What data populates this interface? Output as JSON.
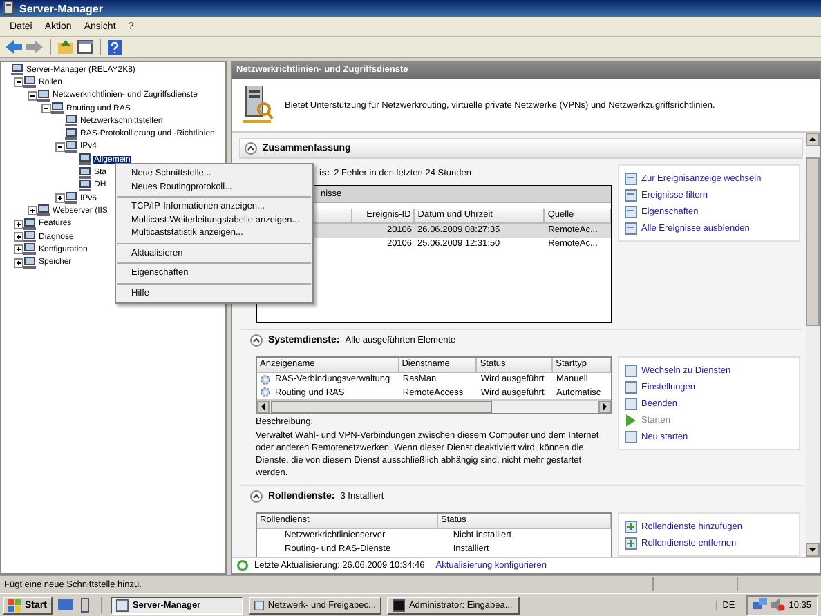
{
  "window": {
    "title": "Server-Manager"
  },
  "menu": [
    "Datei",
    "Aktion",
    "Ansicht",
    "?"
  ],
  "tree": [
    {
      "label": "Server-Manager (RELAY2K8)",
      "selected": false,
      "children": [
        {
          "label": "Rollen",
          "selected": false,
          "expanded": true,
          "children": [
            {
              "label": "Netzwerkrichtlinien- und Zugriffsdienste",
              "selected": false,
              "expanded": true,
              "children": [
                {
                  "label": "Routing und RAS",
                  "selected": false,
                  "expanded": true,
                  "children": [
                    {
                      "label": "Netzwerkschnittstellen",
                      "selected": false
                    },
                    {
                      "label": "RAS-Protokollierung und -Richtlinien",
                      "selected": false
                    },
                    {
                      "label": "IPv4",
                      "selected": false,
                      "expanded": true,
                      "children": [
                        {
                          "label": "Allgemein",
                          "selected": true
                        },
                        {
                          "label": "Sta",
                          "selected": false
                        },
                        {
                          "label": "DH",
                          "selected": false
                        }
                      ]
                    },
                    {
                      "label": "IPv6",
                      "selected": false,
                      "expanded": false
                    }
                  ]
                }
              ]
            },
            {
              "label": "Webserver (IIS",
              "selected": false,
              "expanded": false
            }
          ]
        },
        {
          "label": "Features",
          "selected": false,
          "expanded": false
        },
        {
          "label": "Diagnose",
          "selected": false,
          "expanded": false
        },
        {
          "label": "Konfiguration",
          "selected": false,
          "expanded": false
        },
        {
          "label": "Speicher",
          "selected": false,
          "expanded": false
        }
      ]
    }
  ],
  "context_menu": [
    {
      "kind": "item",
      "label": "Neue Schnittstelle..."
    },
    {
      "kind": "item",
      "label": "Neues Routingprotokoll..."
    },
    {
      "kind": "separator"
    },
    {
      "kind": "item",
      "label": "TCP/IP-Informationen anzeigen..."
    },
    {
      "kind": "item",
      "label": "Multicast-Weiterleitungstabelle anzeigen..."
    },
    {
      "kind": "item",
      "label": "Multicaststatistik anzeigen..."
    },
    {
      "kind": "separator"
    },
    {
      "kind": "item",
      "label": "Aktualisieren"
    },
    {
      "kind": "separator"
    },
    {
      "kind": "item",
      "label": "Eigenschaften"
    },
    {
      "kind": "separator"
    },
    {
      "kind": "item",
      "label": "Hilfe"
    }
  ],
  "pane": {
    "title": "Netzwerkrichtlinien- und Zugriffsdienste",
    "description": "Bietet Unterstützung für Netzwerkrouting, virtuelle private Netzwerke (VPNs) und Netzwerkzugriffsrichtlinien."
  },
  "summary": {
    "title": "Zusammenfassung",
    "label": "is:",
    "text": "2 Fehler in den letzten 24 Stunden",
    "group_title": "nisse",
    "columns": [
      "Ereignis-ID",
      "Datum und Uhrzeit",
      "Quelle"
    ],
    "rows": [
      {
        "cells": [
          "20106",
          "26.06.2009 08:27:35",
          "RemoteAc..."
        ],
        "selected": true
      },
      {
        "cells": [
          "20106",
          "25.06.2009 12:31:50",
          "RemoteAc..."
        ],
        "selected": false
      }
    ],
    "links": [
      {
        "label": "Zur Ereignisanzeige wechseln",
        "disabled": false
      },
      {
        "label": "Ereignisse filtern",
        "disabled": false
      },
      {
        "label": "Eigenschaften",
        "disabled": false
      },
      {
        "label": "Alle Ereignisse ausblenden",
        "disabled": false
      }
    ]
  },
  "services": {
    "title": "Systemdienste:",
    "text": "Alle ausgeführten Elemente",
    "columns": [
      "Anzeigename",
      "Dienstname",
      "Status",
      "Starttyp"
    ],
    "rows": [
      [
        "RAS-Verbindungsverwaltung",
        "RasMan",
        "Wird ausgeführt",
        "Manuell"
      ],
      [
        "Routing und RAS",
        "RemoteAccess",
        "Wird ausgeführt",
        "Automatisc"
      ]
    ],
    "description_label": "Beschreibung:",
    "description": "Verwaltet Wähl- und VPN-Verbindungen zwischen diesem Computer und dem Internet oder anderen Remotenetzwerken. Wenn dieser Dienst deaktiviert wird, können die Dienste, die von diesem Dienst ausschließlich abhängig sind, nicht mehr gestartet werden.",
    "links": [
      {
        "label": "Wechseln zu Diensten",
        "disabled": false
      },
      {
        "label": "Einstellungen",
        "disabled": false
      },
      {
        "label": "Beenden",
        "disabled": false
      },
      {
        "label": "Starten",
        "disabled": true
      },
      {
        "label": "Neu starten",
        "disabled": false
      }
    ]
  },
  "role_services": {
    "title": "Rollendienste:",
    "text": "3 Installiert",
    "columns": [
      "Rollendienst",
      "Status"
    ],
    "rows": [
      [
        "Netzwerkrichtlinienserver",
        "Nicht installiert"
      ],
      [
        "Routing- und RAS-Dienste",
        "Installiert"
      ]
    ],
    "links": [
      {
        "label": "Rollendienste hinzufügen",
        "disabled": false
      },
      {
        "label": "Rollendienste entfernen",
        "disabled": false
      }
    ]
  },
  "footer": {
    "text": "Letzte Aktualisierung: 26.06.2009 10:34:46",
    "link": "Aktualisierung konfigurieren"
  },
  "status_bar": "Fügt eine neue Schnittstelle hinzu.",
  "taskbar": {
    "start": "Start",
    "tasks": [
      {
        "label": "Server-Manager",
        "selected": true
      },
      {
        "label": "Netzwerk- und Freigabec...",
        "selected": false
      },
      {
        "label": "Administrator: Eingabea...",
        "selected": false
      }
    ],
    "language": "DE",
    "clock": "10:35"
  }
}
